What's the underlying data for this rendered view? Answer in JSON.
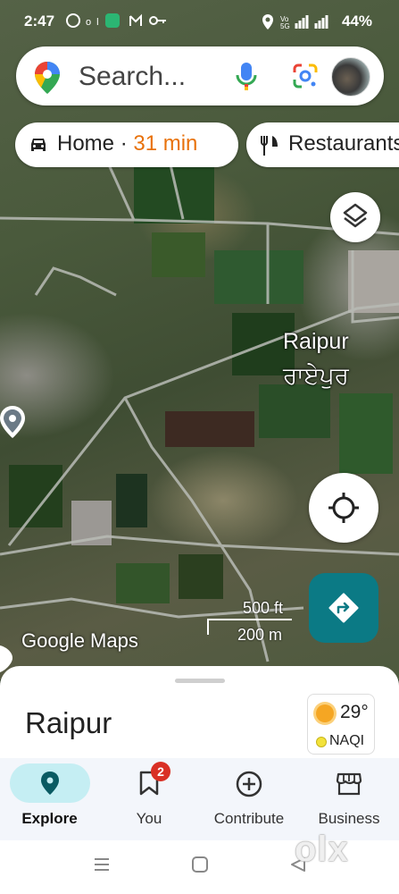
{
  "status_bar": {
    "time": "2:47",
    "battery": "44%"
  },
  "search": {
    "placeholder": "Search..."
  },
  "chips": {
    "home_label": "Home",
    "home_sep": " · ",
    "home_eta": "31 min",
    "restaurant_label": "Restaurants"
  },
  "map": {
    "place_name_en": "Raipur",
    "place_name_pa": "ਰਾਏਪੁਰ",
    "scale_imperial": "500 ft",
    "scale_metric": "200 m",
    "brand": "Google Maps"
  },
  "sheet": {
    "title": "Raipur",
    "weather_temp": "29°",
    "weather_aqi": "NAQI"
  },
  "nav": {
    "explore": "Explore",
    "you": "You",
    "you_badge": "2",
    "contribute": "Contribute",
    "business": "Business"
  },
  "watermark": "olx",
  "colors": {
    "accent": "#0b7a85",
    "eta": "#e8710a",
    "explore_pill": "#c5eef3",
    "badge": "#d93025"
  }
}
